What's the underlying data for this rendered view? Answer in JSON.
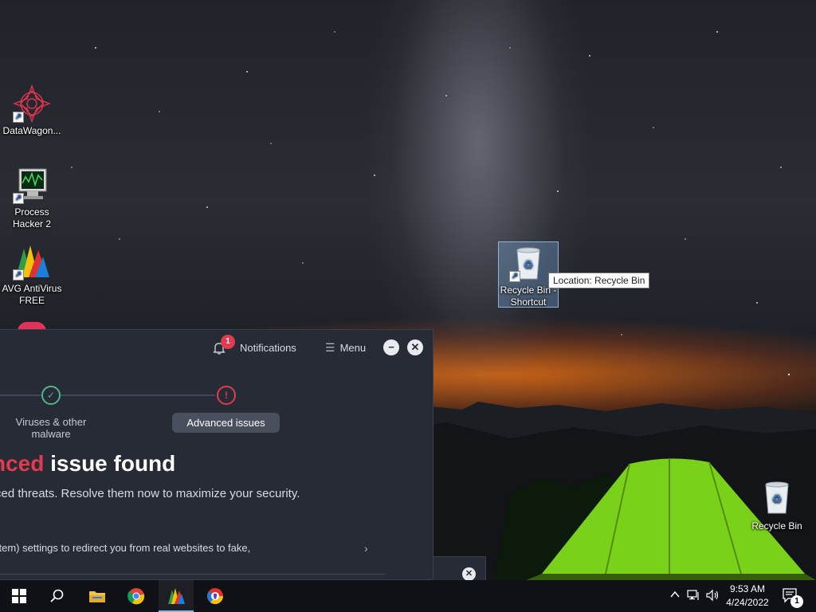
{
  "desktop": {
    "icons": [
      {
        "label": "DataWagon...",
        "icon": "datawagon-icon"
      },
      {
        "label_line1": "Process",
        "label_line2": "Hacker 2",
        "icon": "process-hacker-icon"
      },
      {
        "label_line1": "AVG AntiVirus",
        "label_line2": "FREE",
        "icon": "avg-icon"
      },
      {
        "label_line1": "Recycle Bin -",
        "label_line2": "Shortcut",
        "icon": "recycle-bin-icon"
      },
      {
        "label": "Recycle Bin",
        "icon": "recycle-bin-icon"
      }
    ],
    "tooltip": "Location: Recycle Bin"
  },
  "avg_window": {
    "notifications_label": "Notifications",
    "notifications_count": "1",
    "menu_label": "Menu",
    "step1_label": "Viruses & other malware",
    "step2_label": "Advanced issues",
    "headline_red": "nced",
    "headline_white": " issue found",
    "subline": "ced threats. Resolve them now to maximize your security.",
    "issue_text": "stem) settings to redirect you from real websites to fake,"
  },
  "taskbar": {
    "apps": [
      "start-icon",
      "search-icon",
      "file-explorer-icon",
      "chrome-icon",
      "avg-icon",
      "avg-secure-browser-icon"
    ],
    "time": "9:53 AM",
    "date": "4/24/2022",
    "notification_count": "1"
  },
  "colors": {
    "accent_red": "#e23a4e",
    "ok_green": "#4fb38c",
    "window_bg": "#272b36",
    "taskbar_bg": "#0f1117"
  }
}
